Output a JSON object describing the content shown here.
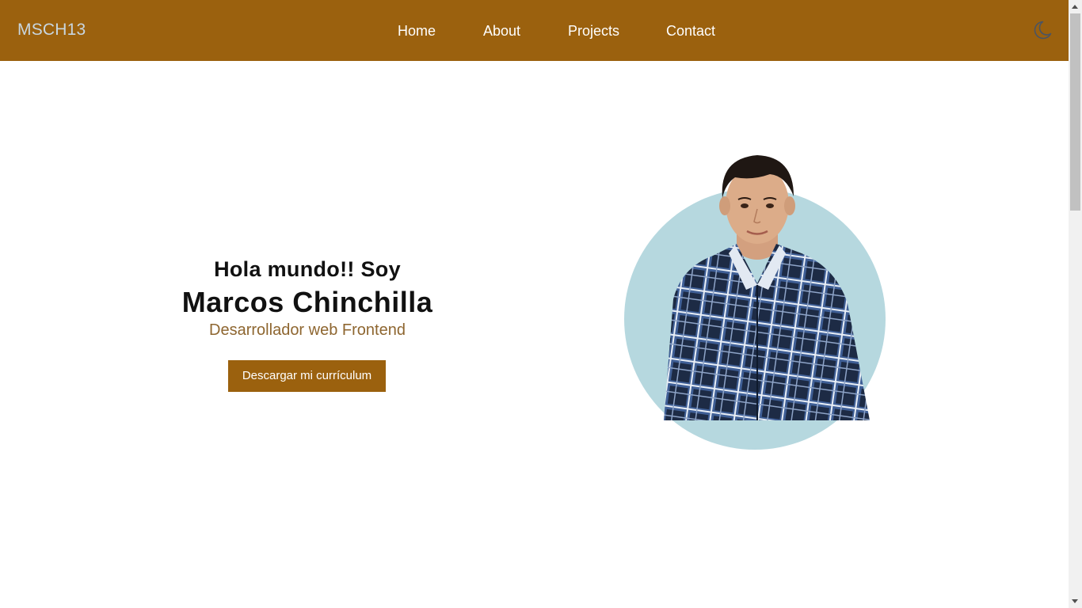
{
  "nav": {
    "logo": "MSCH13",
    "links": [
      "Home",
      "About",
      "Projects",
      "Contact"
    ],
    "theme_toggle_icon": "moon-icon"
  },
  "hero": {
    "greeting": "Hola mundo!! Soy",
    "name": "Marcos Chinchilla",
    "role": "Desarrollador web Frontend",
    "cta_label": "Descargar mi currículum"
  },
  "colors": {
    "brand": "#9b610e",
    "logo_text": "#c8d6e0",
    "role_text": "#8e6630",
    "portrait_circle": "#b6d8df"
  }
}
